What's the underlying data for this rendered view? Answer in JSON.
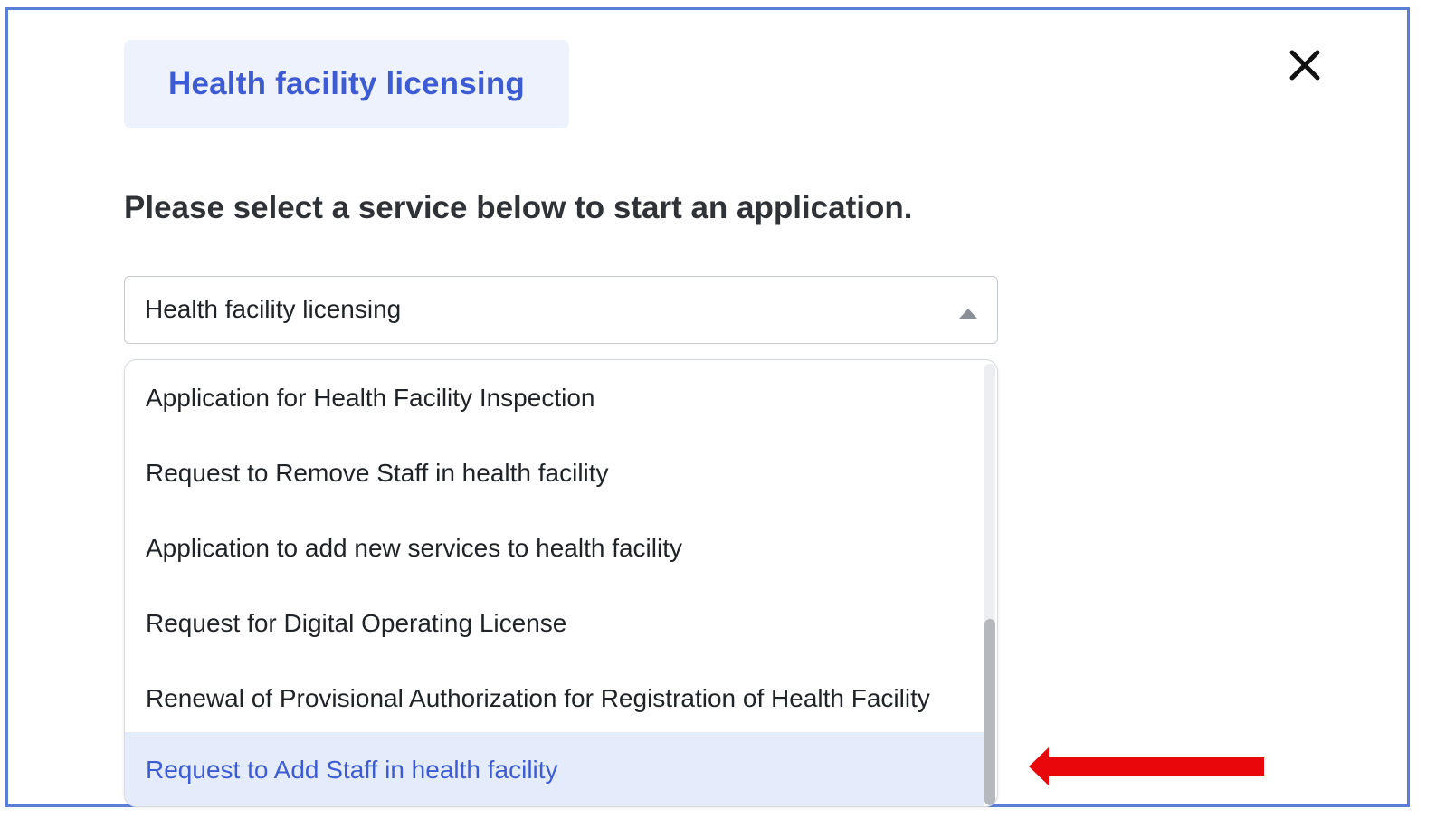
{
  "modal": {
    "title": "Health facility licensing",
    "prompt": "Please select a service below to start an application.",
    "close_icon": "close-icon"
  },
  "select": {
    "value": "Health facility licensing",
    "caret_icon": "caret-up-icon"
  },
  "options": [
    {
      "label": "Application for Health Facility Inspection"
    },
    {
      "label": "Request to Remove Staff in health facility"
    },
    {
      "label": "Application to add new services to health facility"
    },
    {
      "label": "Request for Digital Operating License"
    },
    {
      "label": "Renewal of Provisional Authorization for Registration of Health Facility"
    },
    {
      "label": "Request to Add Staff in health facility",
      "highlighted": true
    }
  ],
  "annotation": {
    "arrow_icon": "red-arrow-icon",
    "color": "#e8070b"
  },
  "colors": {
    "accent": "#3d5bd2",
    "frame": "#5b7fd6",
    "highlight_bg": "#e4ecfb"
  }
}
